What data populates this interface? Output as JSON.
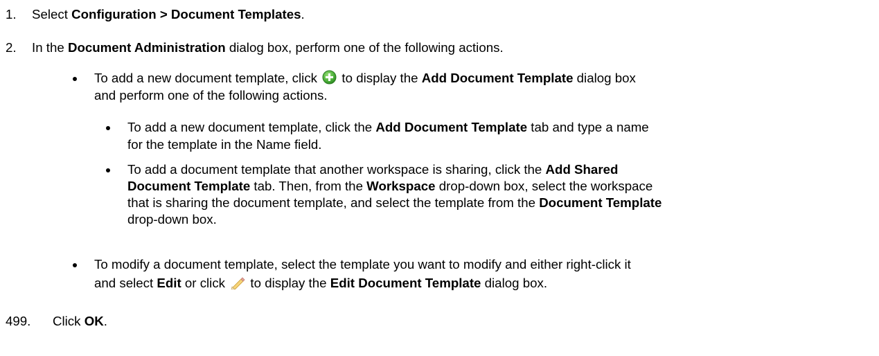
{
  "steps": [
    {
      "number": "1.",
      "text_before": "Select ",
      "bold": "Configuration > Document Templates",
      "text_after": "."
    },
    {
      "number": "2.",
      "text_before": "In the ",
      "bold": "Document Administration",
      "text_after": " dialog box, perform one of the following actions."
    },
    {
      "number": "499.",
      "text_before": "Click ",
      "bold": "OK",
      "text_after": "."
    }
  ],
  "add_item": {
    "line1_before": "To add a new document template, click ",
    "line1_after": " to display the ",
    "line1_bold": "Add Document Template",
    "line1_end": " dialog box",
    "line2": "and perform one of the following actions.",
    "icon": "green-plus-circle-icon"
  },
  "sub_new": {
    "line1_before": "To add a new document template, click the ",
    "line1_bold": "Add Document Template",
    "line1_after": " tab and type a name",
    "line2": "for the template in the Name field."
  },
  "sub_shared": {
    "line1_before": "To add a document template that another workspace is sharing, click the ",
    "line1_bold": "Add Shared",
    "line2_bold": "Document Template",
    "line2_before_ws": " tab. Then, from the ",
    "line2_bold2": "Workspace",
    "line2_after": " drop-down box, select the workspace",
    "line3_before": "that is sharing the document template, and select the template from the ",
    "line3_bold": "Document Template",
    "line4": "drop-down  box."
  },
  "modify_item": {
    "line1": "To modify a document template, select the template you want to modify and either right-click it",
    "line2_before": "and select ",
    "line2_bold": "Edit",
    "line2_mid": " or click ",
    "line2_after": " to display the ",
    "line2_bold2": "Edit Document Template",
    "line2_end": " dialog box.",
    "icon": "pencil-icon"
  }
}
